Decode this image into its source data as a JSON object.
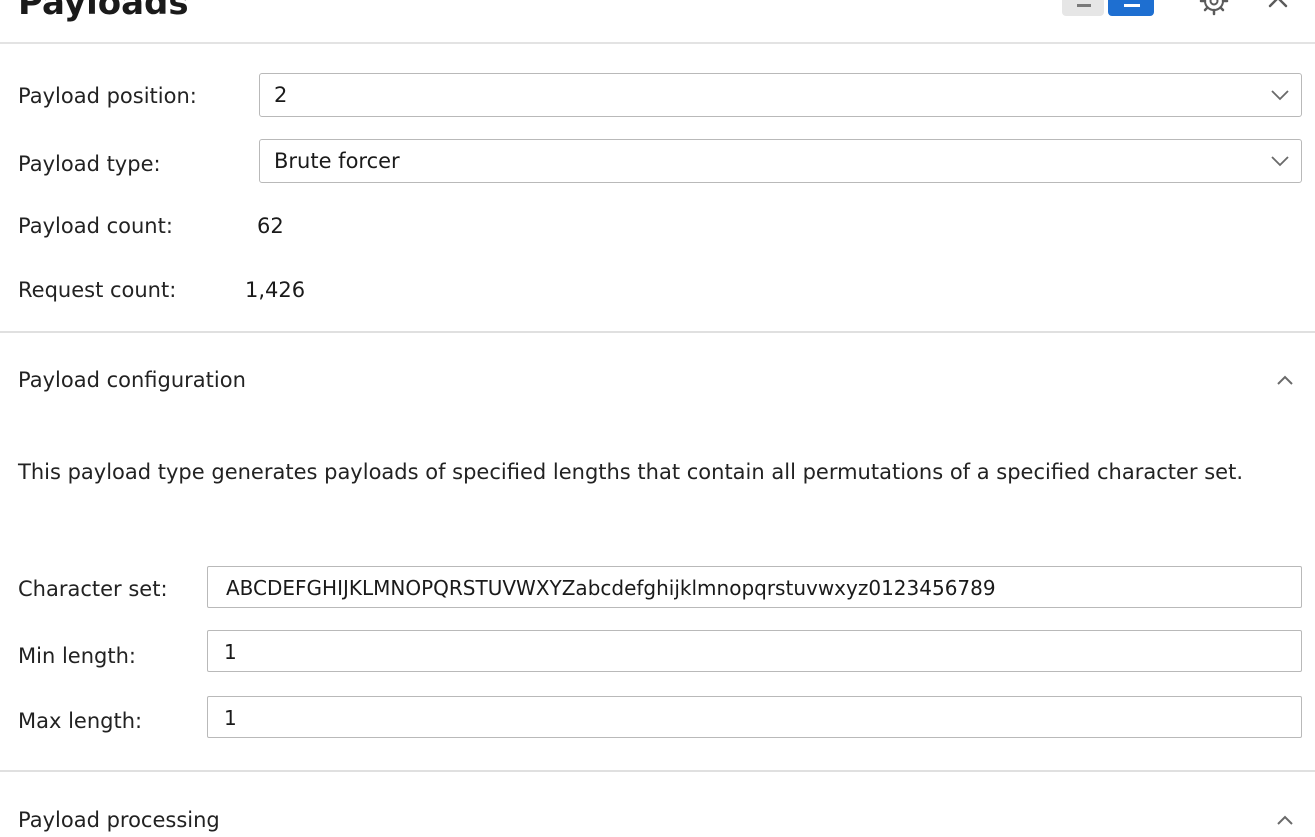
{
  "header": {
    "title": "Payloads",
    "icons": [
      "list-view-icon",
      "split-view-icon",
      "gear-icon",
      "close-icon"
    ],
    "accent": "#1e6fd1"
  },
  "payloads": {
    "position_label": "Payload position:",
    "position_value": "2",
    "type_label": "Payload type:",
    "type_value": "Brute forcer",
    "payload_count_label": "Payload count:",
    "payload_count_value": "62",
    "request_count_label": "Request count:",
    "request_count_value": "1,426"
  },
  "configuration": {
    "title": "Payload configuration",
    "description": "This payload type generates payloads of specified lengths that contain all permutations of a specified character set.",
    "charset_label": "Character set:",
    "charset_value": "ABCDEFGHIJKLMNOPQRSTUVWXYZabcdefghijklmnopqrstuvwxyz0123456789",
    "min_length_label": "Min length:",
    "min_length_value": "1",
    "max_length_label": "Max length:",
    "max_length_value": "1"
  },
  "processing": {
    "title": "Payload processing"
  }
}
